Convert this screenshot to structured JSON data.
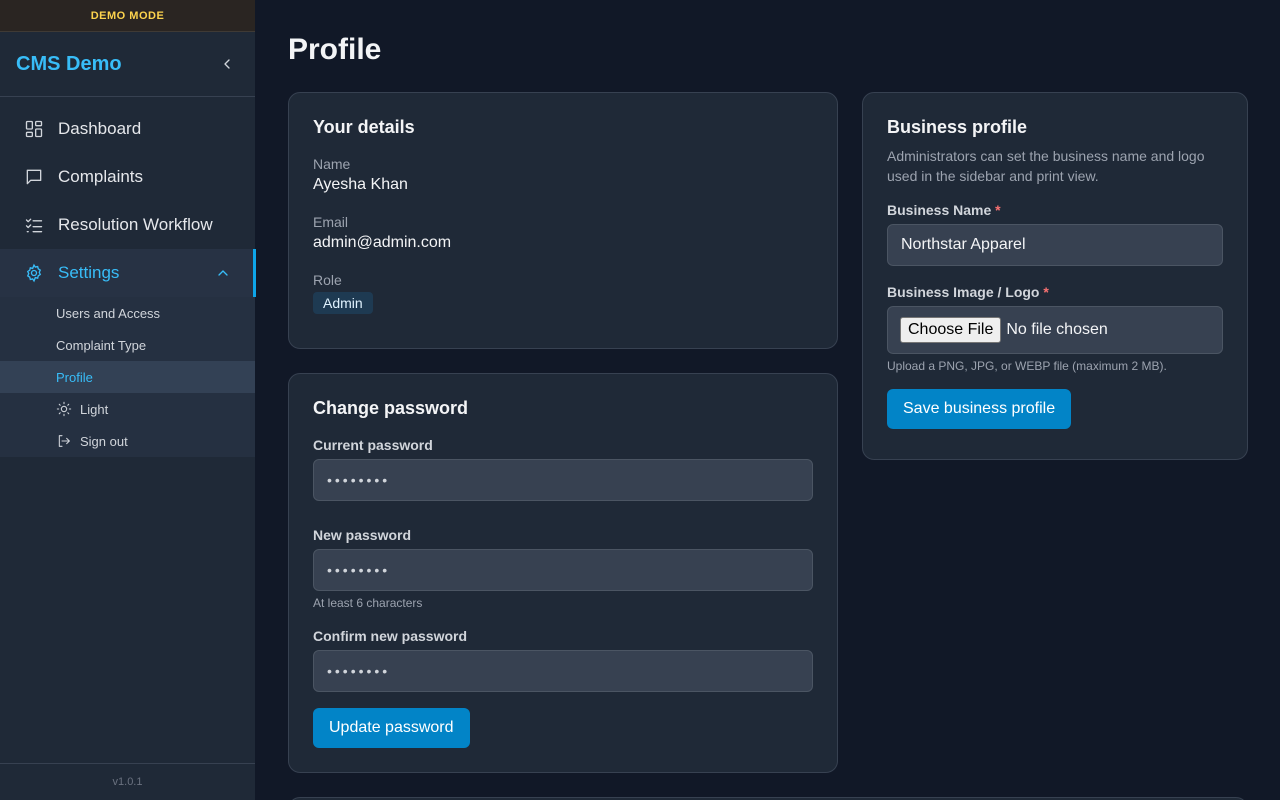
{
  "sidebar": {
    "demo_banner": "DEMO MODE",
    "brand": "CMS Demo",
    "nav": [
      {
        "label": "Dashboard",
        "icon": "dashboard-icon"
      },
      {
        "label": "Complaints",
        "icon": "chat-bubble-icon"
      },
      {
        "label": "Resolution Workflow",
        "icon": "checklist-icon"
      },
      {
        "label": "Settings",
        "icon": "gear-icon"
      }
    ],
    "settings_sub": [
      {
        "label": "Users and Access"
      },
      {
        "label": "Complaint Type"
      },
      {
        "label": "Profile"
      }
    ],
    "theme_toggle": "Light",
    "sign_out": "Sign out",
    "version": "v1.0.1"
  },
  "page": {
    "title": "Profile"
  },
  "details": {
    "title": "Your details",
    "name_label": "Name",
    "name_value": "Ayesha Khan",
    "email_label": "Email",
    "email_value": "admin@admin.com",
    "role_label": "Role",
    "role_value": "Admin"
  },
  "password": {
    "title": "Change password",
    "current_label": "Current password",
    "current_value": "••••••••",
    "new_label": "New password",
    "new_value": "••••••••",
    "new_hint": "At least 6 characters",
    "confirm_label": "Confirm new password",
    "confirm_value": "••••••••",
    "submit": "Update password"
  },
  "business": {
    "title": "Business profile",
    "description": "Administrators can set the business name and logo used in the sidebar and print view.",
    "name_label": "Business Name",
    "name_value": "Northstar Apparel",
    "logo_label": "Business Image / Logo",
    "choose_file": "Choose File",
    "no_file": "No file chosen",
    "logo_hint": "Upload a PNG, JPG, or WEBP file (maximum 2 MB).",
    "required_mark": "*",
    "submit": "Save business profile"
  },
  "colors": {
    "accent": "#38bdf8",
    "primary_button": "#0284c7",
    "background": "#111827",
    "card": "#1f2937"
  }
}
